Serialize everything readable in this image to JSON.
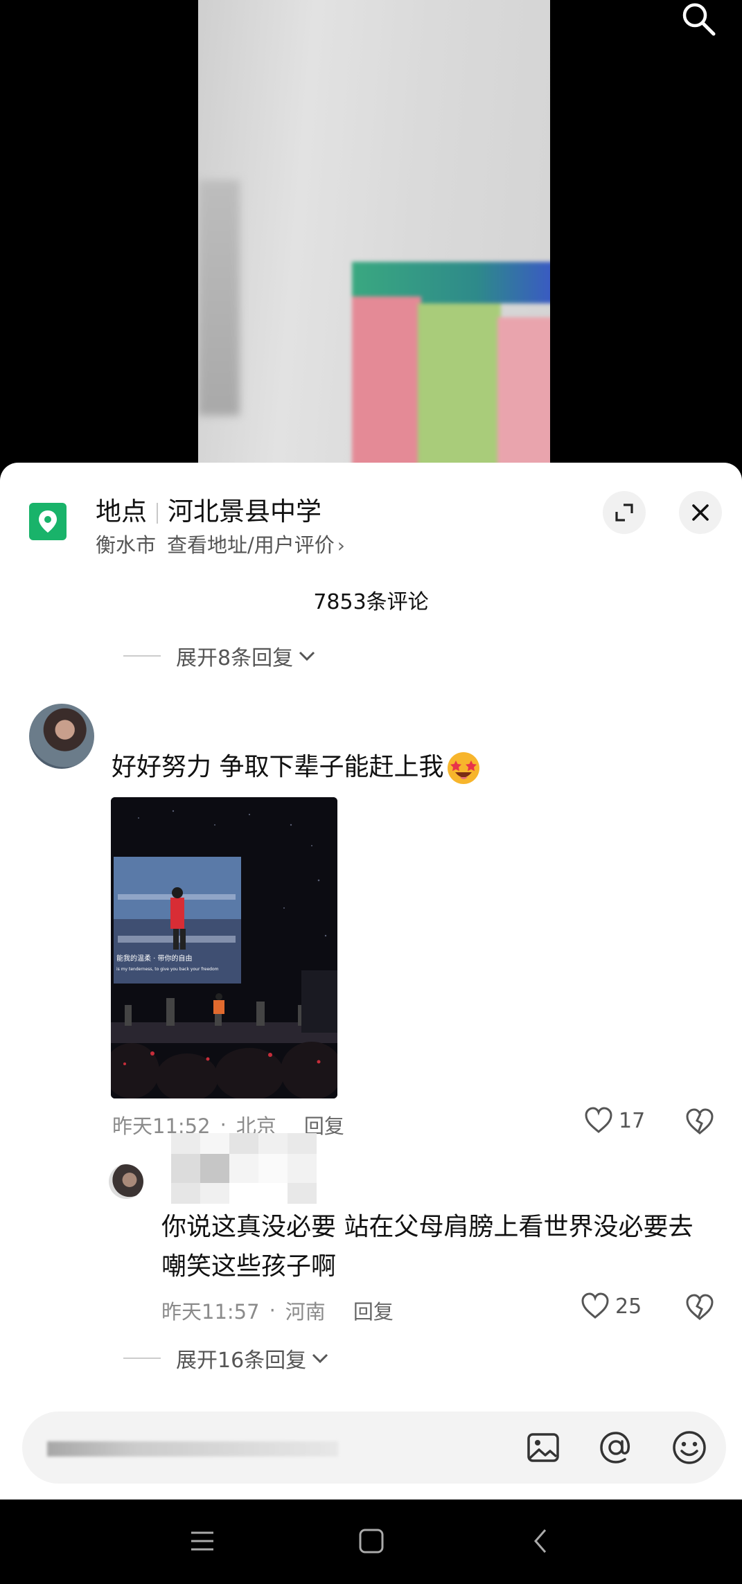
{
  "icons": {
    "search": "search-icon",
    "location_pin": "location-pin-icon",
    "expand": "expand-icon",
    "close": "close-icon",
    "chevron_right": "chevron-right-icon",
    "chevron_down": "chevron-down-icon",
    "heart": "heart-icon",
    "broken_heart": "broken-heart-icon",
    "image": "image-icon",
    "at": "at-icon",
    "emoji": "emoji-icon",
    "menu": "menu-icon",
    "home": "home-icon",
    "back": "back-icon"
  },
  "colors": {
    "location_accent": "#19b36a",
    "sheet_bg": "#ffffff",
    "muted_text": "#8a8a8a"
  },
  "location": {
    "label": "地点",
    "name": "河北景县中学",
    "city": "衡水市",
    "link": "查看地址/用户评价",
    "chevron": "›"
  },
  "comments_header": {
    "count_text": "7853条评论"
  },
  "expand_top": {
    "label": "展开8条回复"
  },
  "comment": {
    "text": "好好努力 争取下辈子能赶上我",
    "emoji": "star-struck-emoji",
    "time": "昨天11:52",
    "dot": "·",
    "region": "北京",
    "reply_label": "回复",
    "likes": "17"
  },
  "reply": {
    "text": "你说这真没必要 站在父母肩膀上看世界没必要去嘲笑这些孩子啊",
    "time": "昨天11:57",
    "dot": "·",
    "region": "河南",
    "reply_label": "回复",
    "likes": "25"
  },
  "expand_bottom": {
    "label": "展开16条回复"
  }
}
